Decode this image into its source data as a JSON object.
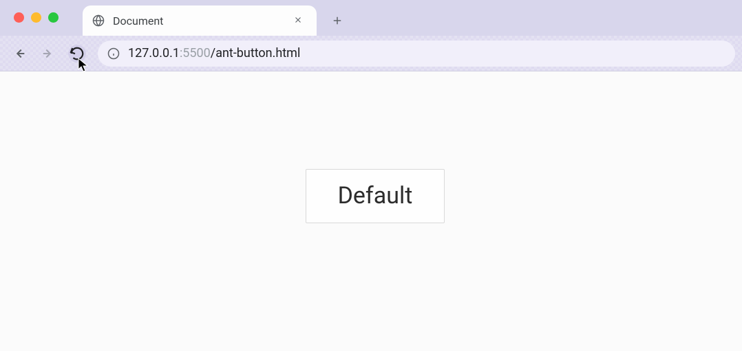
{
  "tab": {
    "title": "Document"
  },
  "address": {
    "host": "127.0.0.1",
    "port": ":5500",
    "path": "/ant-button.html"
  },
  "page": {
    "button_label": "Default"
  }
}
